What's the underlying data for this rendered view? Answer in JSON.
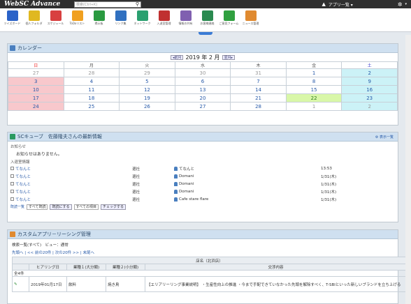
{
  "topbar": {
    "logo": "WebSC Advance",
    "search_placeholder": "検索(Ctrl+K)",
    "app_selector": "アプリ一覧 ▾"
  },
  "toolbar": [
    {
      "label": "ツイズボード",
      "color": "#2a62c8"
    },
    {
      "label": "個人フォルダ",
      "color": "#e0b820"
    },
    {
      "label": "スケジュール",
      "color": "#d84040"
    },
    {
      "label": "ToDoリスト",
      "color": "#f0a020"
    },
    {
      "label": "掲示板",
      "color": "#2a9a40"
    },
    {
      "label": "リンク集",
      "color": "#3070c0"
    },
    {
      "label": "ネットワーク",
      "color": "#2aa070"
    },
    {
      "label": "入退室管理",
      "color": "#c03030"
    },
    {
      "label": "情報の共有",
      "color": "#8060b0"
    },
    {
      "label": "お客様連絡",
      "color": "#2a8a50"
    },
    {
      "label": "ご意見フォーム",
      "color": "#30a040"
    },
    {
      "label": "ニュース管理",
      "color": "#e08a30"
    }
  ],
  "calendar": {
    "title": "カレンダー",
    "prev": "◂前月",
    "next": "翌月▸",
    "month_label": "2019 年 2 月",
    "weekdays": [
      "日",
      "月",
      "火",
      "水",
      "木",
      "金",
      "土"
    ],
    "weeks": [
      [
        "27",
        "28",
        "29",
        "30",
        "31",
        "1",
        "2"
      ],
      [
        "3",
        "4",
        "5",
        "6",
        "7",
        "8",
        "9"
      ],
      [
        "10",
        "11",
        "12",
        "13",
        "14",
        "15",
        "16"
      ],
      [
        "17",
        "18",
        "19",
        "20",
        "21",
        "22",
        "23"
      ],
      [
        "24",
        "25",
        "26",
        "27",
        "28",
        "1",
        "2"
      ]
    ]
  },
  "notice": {
    "title": "SCキューブ　佐藤隆夫さんの最新情報",
    "action": "⚙ 表示一覧",
    "sec1": "お知らせ",
    "empty": "お知らせはありません。",
    "sec2": "入退室情報",
    "rows": [
      {
        "name": "てなんと",
        "status": "退社",
        "person": "てなんと",
        "time": "13:53"
      },
      {
        "name": "てなんと",
        "status": "退社",
        "person": "Domani",
        "time": "1/31(木)"
      },
      {
        "name": "てなんと",
        "status": "退社",
        "person": "Domani",
        "time": "1/31(木)"
      },
      {
        "name": "てなんと",
        "status": "退社",
        "person": "Domani",
        "time": "1/31(木)"
      },
      {
        "name": "てなんと",
        "status": "退社",
        "person": "Cafe stare flare",
        "time": "1/31(木)"
      }
    ],
    "foot_list": "既読一覧",
    "foot_sel": "すべて既読",
    "foot_btn": "既読にする",
    "foot_sel2": "すべての項目",
    "foot_btn2": "チェックする"
  },
  "custom": {
    "title": "カスタムアプリ－リーシング管理",
    "breadcrumb": "検索一覧(すべて)　ビュー：通常",
    "pager": "先頭へ | << 前の20件 | 次の20件 >> | 末尾へ",
    "group_header": "店名（北浜店）",
    "cols": [
      "",
      "ヒアリング日",
      "業種１(大分類)",
      "業種２(小分類)",
      "交渉内容"
    ],
    "row_count": "全4件",
    "row1": {
      "date": "2019年01月17日",
      "c1": "飲料",
      "c2": "焼き鳥",
      "text": "【エリアリーリング事業説明】 ・生産性向上の推進 ・今まで手配できていなかった先頭を解除すべく、T-SBIといった新しいブランドを立ち上げる"
    }
  }
}
